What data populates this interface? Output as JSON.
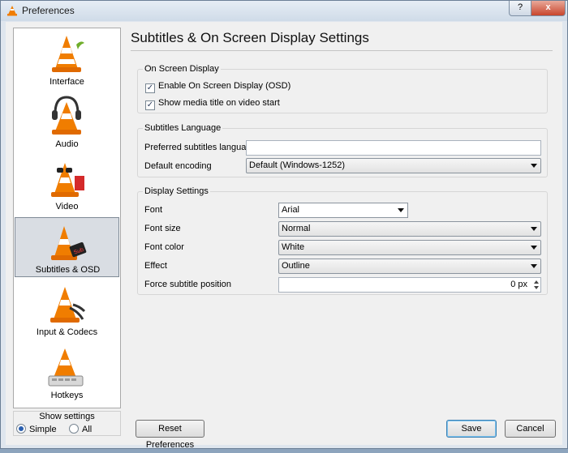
{
  "window": {
    "title": "Preferences",
    "help_label": "?",
    "close_label": "x"
  },
  "sidebar": {
    "items": [
      {
        "label": "Interface"
      },
      {
        "label": "Audio"
      },
      {
        "label": "Video"
      },
      {
        "label": "Subtitles & OSD"
      },
      {
        "label": "Input & Codecs"
      },
      {
        "label": "Hotkeys"
      }
    ],
    "selected": "Subtitles & OSD"
  },
  "show_settings": {
    "title": "Show settings",
    "simple_label": "Simple",
    "all_label": "All",
    "selected": "Simple"
  },
  "panel": {
    "title": "Subtitles & On Screen Display Settings",
    "osd": {
      "title": "On Screen Display",
      "enable_label": "Enable On Screen Display (OSD)",
      "enable_checked": true,
      "media_title_label": "Show media title on video start",
      "media_title_checked": true
    },
    "language": {
      "title": "Subtitles Language",
      "preferred_label": "Preferred subtitles language",
      "preferred_value": "",
      "encoding_label": "Default encoding",
      "encoding_value": "Default (Windows-1252)"
    },
    "display": {
      "title": "Display Settings",
      "font_label": "Font",
      "font_value": "Arial",
      "size_label": "Font size",
      "size_value": "Normal",
      "color_label": "Font color",
      "color_value": "White",
      "effect_label": "Effect",
      "effect_value": "Outline",
      "position_label": "Force subtitle position",
      "position_value": "0 px"
    }
  },
  "footer": {
    "reset_label": "Reset Preferences",
    "save_label": "Save",
    "cancel_label": "Cancel"
  },
  "colors": {
    "cone_orange": "#f07d00",
    "accent": "#3c7fb1"
  }
}
